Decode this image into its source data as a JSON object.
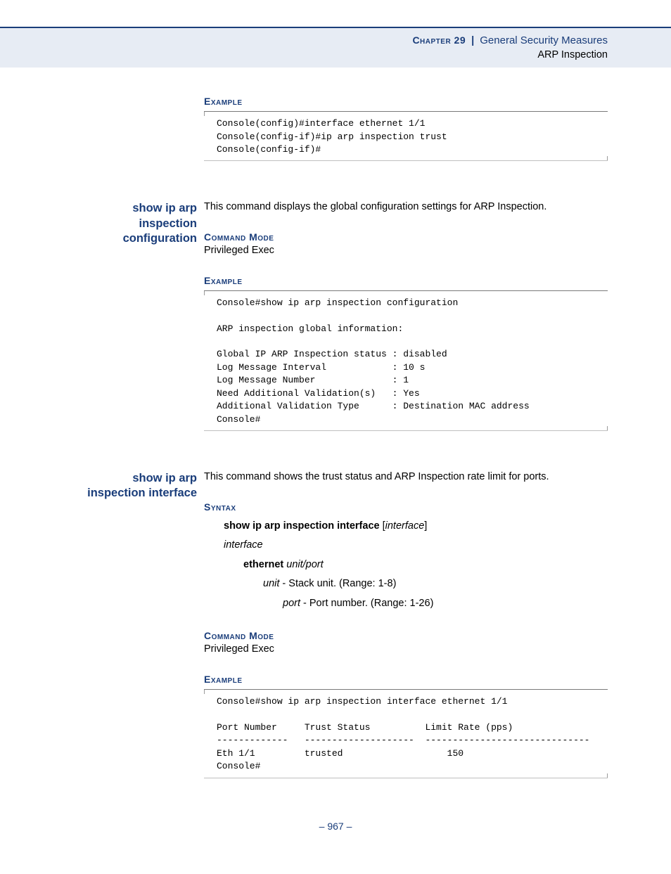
{
  "header": {
    "chapter_label": "Chapter 29",
    "bar": "|",
    "chapter_title": "General Security Measures",
    "subtitle": "ARP Inspection"
  },
  "sec1": {
    "example_label": "Example",
    "code": "Console(config)#interface ethernet 1/1\nConsole(config-if)#ip arp inspection trust\nConsole(config-if)#"
  },
  "sec2": {
    "name_line1": "show ip arp",
    "name_line2": "inspection",
    "name_line3": "configuration",
    "desc": "This command displays the global configuration settings for ARP Inspection.",
    "cmdmode_label": "Command Mode",
    "cmdmode_val": "Privileged Exec",
    "example_label": "Example",
    "code": "Console#show ip arp inspection configuration\n\nARP inspection global information:\n\nGlobal IP ARP Inspection status : disabled\nLog Message Interval            : 10 s\nLog Message Number              : 1\nNeed Additional Validation(s)   : Yes\nAdditional Validation Type      : Destination MAC address\nConsole#"
  },
  "sec3": {
    "name_line1": "show ip arp",
    "name_line2": "inspection interface",
    "desc": "This command shows the trust status and ARP Inspection rate limit for ports.",
    "syntax_label": "Syntax",
    "syntax_cmd_b": "show ip arp inspection interface",
    "syntax_cmd_arg": "interface",
    "interface_lbl": "interface",
    "ethernet_b": "ethernet",
    "ethernet_args": "unit/port",
    "unit_i": "unit",
    "unit_rest": " - Stack unit. (Range: 1-8)",
    "port_i": "port",
    "port_rest": " - Port number. (Range: 1-26)",
    "cmdmode_label": "Command Mode",
    "cmdmode_val": "Privileged Exec",
    "example_label": "Example",
    "code": "Console#show ip arp inspection interface ethernet 1/1\n\nPort Number     Trust Status          Limit Rate (pps)\n-------------   --------------------  ------------------------------\nEth 1/1         trusted                   150\nConsole#"
  },
  "footer": {
    "page": "– 967 –"
  }
}
